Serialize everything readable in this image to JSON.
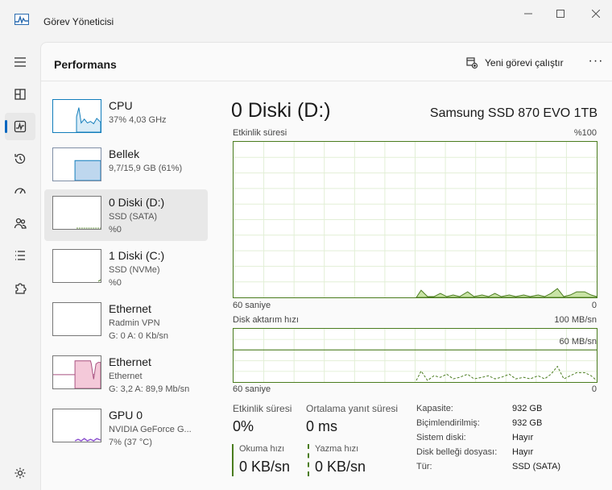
{
  "window": {
    "title": "Görev Yöneticisi"
  },
  "header": {
    "page_title": "Performans",
    "run_task": "Yeni görevi çalıştır",
    "more": "···"
  },
  "sidebar": [
    {
      "name": "CPU",
      "sub1": "37% 4,03 GHz",
      "sub2": ""
    },
    {
      "name": "Bellek",
      "sub1": "9,7/15,9 GB (61%)",
      "sub2": ""
    },
    {
      "name": "0 Diski (D:)",
      "sub1": "SSD (SATA)",
      "sub2": "%0"
    },
    {
      "name": "1 Diski (C:)",
      "sub1": "SSD (NVMe)",
      "sub2": "%0"
    },
    {
      "name": "Ethernet",
      "sub1": "Radmin VPN",
      "sub2": "G: 0 A: 0 Kb/sn"
    },
    {
      "name": "Ethernet",
      "sub1": "Ethernet",
      "sub2": "G: 3,2 A: 89,9 Mb/sn"
    },
    {
      "name": "GPU 0",
      "sub1": "NVIDIA GeForce G...",
      "sub2": "7% (37 °C)"
    }
  ],
  "detail": {
    "title": "0 Diski (D:)",
    "device": "Samsung SSD 870 EVO 1TB",
    "activity_graph": {
      "label": "Etkinlik süresi",
      "max": "%100",
      "time_label": "60 saniye",
      "min": "0"
    },
    "transfer_graph": {
      "label": "Disk aktarım hızı",
      "max": "100 MB/sn",
      "line_label": "60 MB/sn",
      "time_label": "60 saniye",
      "min": "0"
    },
    "stats": {
      "activity_label": "Etkinlik süresi",
      "activity_value": "0%",
      "response_label": "Ortalama yanıt süresi",
      "response_value": "0 ms",
      "read_label": "Okuma hızı",
      "read_value": "0 KB/sn",
      "write_label": "Yazma hızı",
      "write_value": "0 KB/sn"
    },
    "properties": [
      {
        "key": "Kapasite:",
        "value": "932 GB"
      },
      {
        "key": "Biçimlendirilmiş:",
        "value": "932 GB"
      },
      {
        "key": "Sistem diski:",
        "value": "Hayır"
      },
      {
        "key": "Disk belleği dosyası:",
        "value": "Hayır"
      },
      {
        "key": "Tür:",
        "value": "SSD (SATA)"
      }
    ]
  },
  "colors": {
    "accent": "#0067c0",
    "disk_green": "#4a7c1e",
    "disk_fill": "#c9e4a6",
    "cpu": "#117dbb",
    "ethernet": "#a74f7f",
    "gpu": "#8b4fcf"
  }
}
